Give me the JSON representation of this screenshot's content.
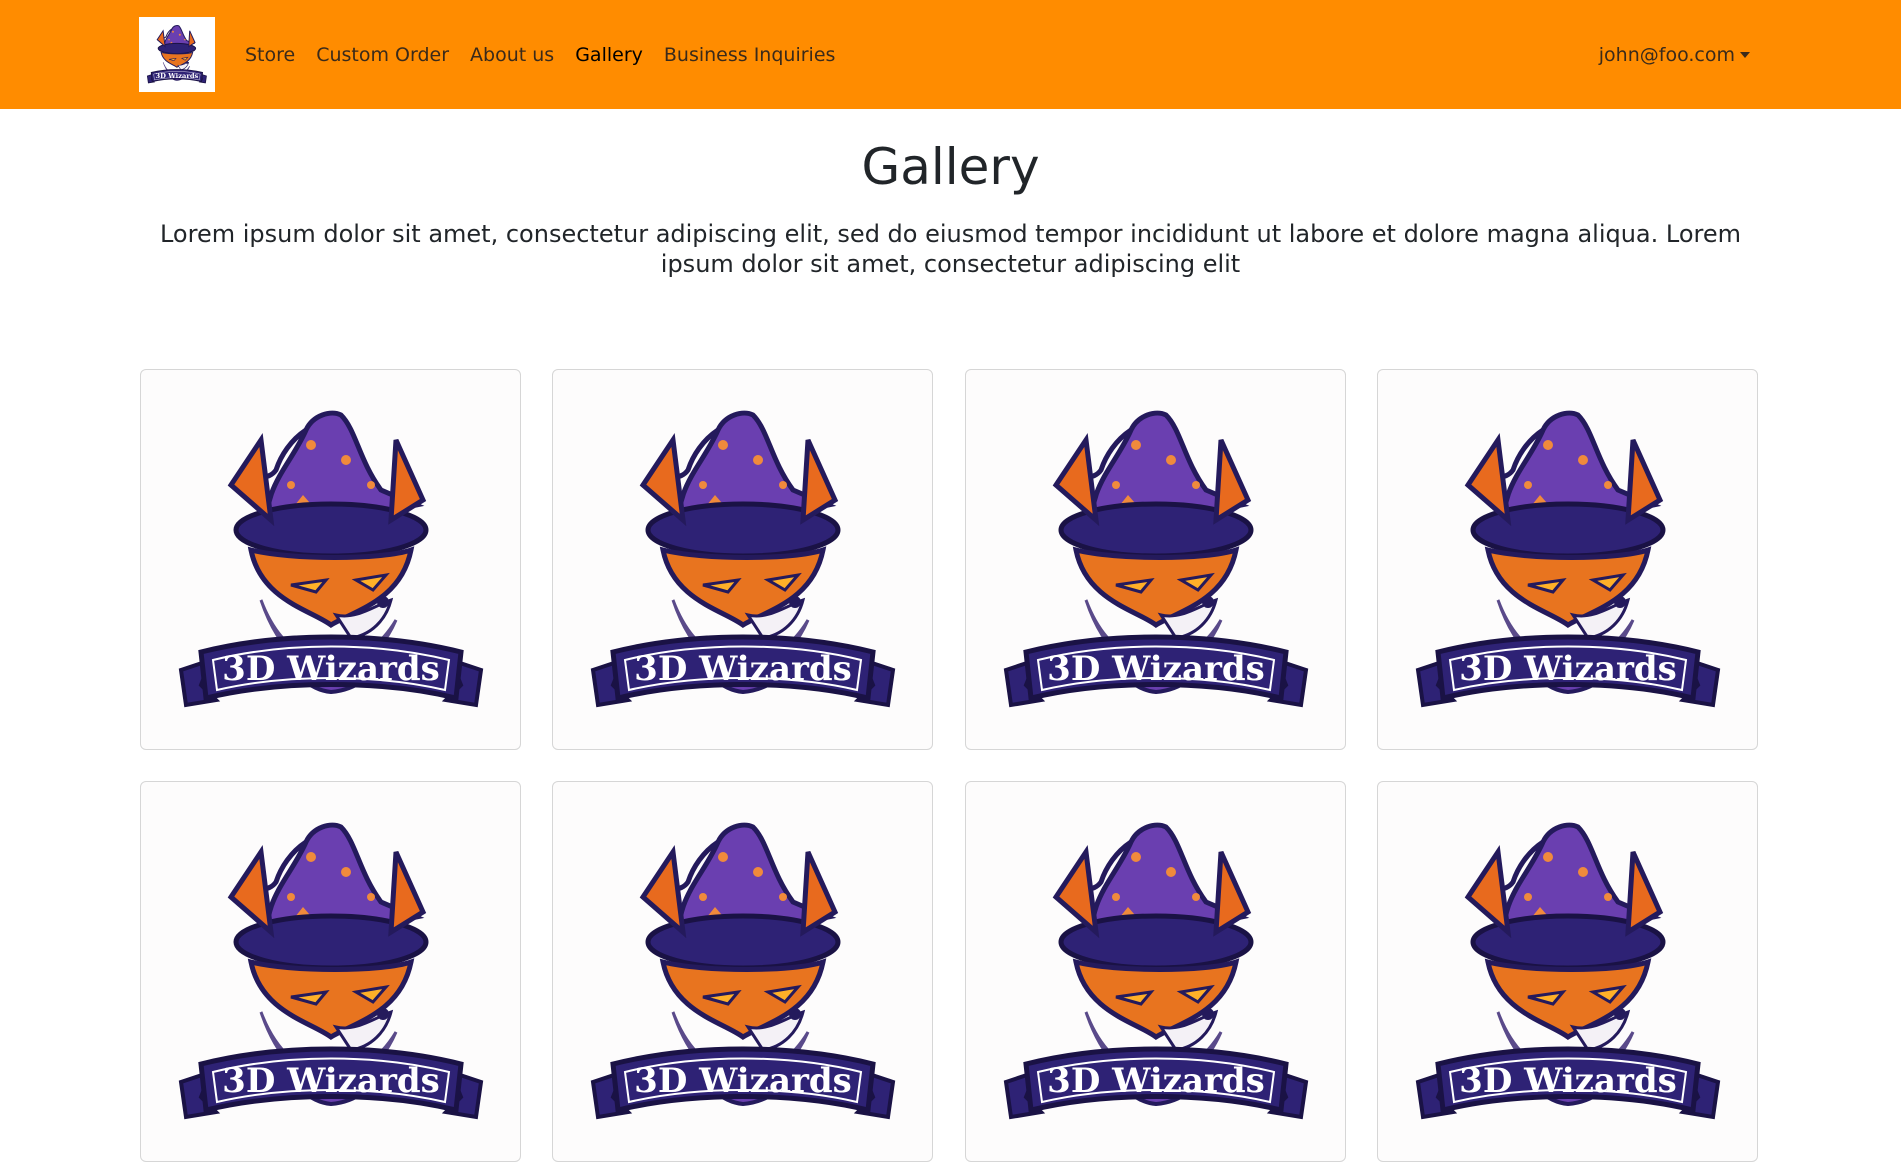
{
  "navbar": {
    "brand_logo": "3D Wizards",
    "links": [
      {
        "label": "Store",
        "active": false
      },
      {
        "label": "Custom Order",
        "active": false
      },
      {
        "label": "About us",
        "active": false
      },
      {
        "label": "Gallery",
        "active": true
      },
      {
        "label": "Business Inquiries",
        "active": false
      }
    ],
    "user_email": "john@foo.com",
    "background_color": "#ff8c00"
  },
  "page": {
    "title": "Gallery",
    "lead": "Lorem ipsum dolor sit amet, consectetur adipiscing elit, sed do eiusmod tempor incididunt ut labore et dolore magna aliqua. Lorem ipsum dolor sit amet, consectetur adipiscing elit"
  },
  "gallery": {
    "items": [
      {
        "logo_text": "3D Wizards"
      },
      {
        "logo_text": "3D Wizards"
      },
      {
        "logo_text": "3D Wizards"
      },
      {
        "logo_text": "3D Wizards"
      },
      {
        "logo_text": "3D Wizards"
      },
      {
        "logo_text": "3D Wizards"
      },
      {
        "logo_text": "3D Wizards"
      },
      {
        "logo_text": "3D Wizards"
      }
    ]
  }
}
